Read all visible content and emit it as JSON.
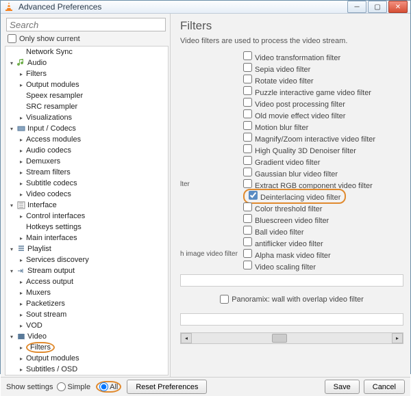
{
  "window": {
    "title": "Advanced Preferences"
  },
  "search": {
    "placeholder": "Search"
  },
  "only_show": "Only show current",
  "tree": {
    "items": [
      {
        "label": "Network Sync",
        "child": true
      },
      {
        "label": "Audio",
        "expand": "▾",
        "icon": "audio"
      },
      {
        "label": "Filters",
        "child": true,
        "caret": "▸"
      },
      {
        "label": "Output modules",
        "child": true,
        "caret": "▸"
      },
      {
        "label": "Speex resampler",
        "child": true
      },
      {
        "label": "SRC resampler",
        "child": true
      },
      {
        "label": "Visualizations",
        "child": true,
        "caret": "▸"
      },
      {
        "label": "Input / Codecs",
        "expand": "▾",
        "icon": "codec"
      },
      {
        "label": "Access modules",
        "child": true,
        "caret": "▸"
      },
      {
        "label": "Audio codecs",
        "child": true,
        "caret": "▸"
      },
      {
        "label": "Demuxers",
        "child": true,
        "caret": "▸"
      },
      {
        "label": "Stream filters",
        "child": true,
        "caret": "▸"
      },
      {
        "label": "Subtitle codecs",
        "child": true,
        "caret": "▸"
      },
      {
        "label": "Video codecs",
        "child": true,
        "caret": "▸"
      },
      {
        "label": "Interface",
        "expand": "▾",
        "icon": "iface"
      },
      {
        "label": "Control interfaces",
        "child": true,
        "caret": "▸"
      },
      {
        "label": "Hotkeys settings",
        "child": true
      },
      {
        "label": "Main interfaces",
        "child": true,
        "caret": "▸"
      },
      {
        "label": "Playlist",
        "expand": "▾",
        "icon": "playlist"
      },
      {
        "label": "Services discovery",
        "child": true,
        "caret": "▸"
      },
      {
        "label": "Stream output",
        "expand": "▾",
        "icon": "sout"
      },
      {
        "label": "Access output",
        "child": true,
        "caret": "▸"
      },
      {
        "label": "Muxers",
        "child": true,
        "caret": "▸"
      },
      {
        "label": "Packetizers",
        "child": true,
        "caret": "▸"
      },
      {
        "label": "Sout stream",
        "child": true,
        "caret": "▸"
      },
      {
        "label": "VOD",
        "child": true,
        "caret": "▸"
      },
      {
        "label": "Video",
        "expand": "▾",
        "icon": "video"
      },
      {
        "label": "Filters",
        "child": true,
        "caret": "▸",
        "circled": true
      },
      {
        "label": "Output modules",
        "child": true,
        "caret": "▸"
      },
      {
        "label": "Subtitles / OSD",
        "child": true,
        "caret": "▸"
      }
    ]
  },
  "right": {
    "title": "Filters",
    "desc": "Video filters are used to process the video stream.",
    "rows": [
      {
        "side": "",
        "label": "Video transformation filter"
      },
      {
        "side": "",
        "label": "Sepia video filter"
      },
      {
        "side": "",
        "label": "Rotate video filter"
      },
      {
        "side": "",
        "label": "Puzzle interactive game video filter"
      },
      {
        "side": "",
        "label": "Video post processing filter"
      },
      {
        "side": "",
        "label": "Old movie effect video filter"
      },
      {
        "side": "",
        "label": "Motion blur filter"
      },
      {
        "side": "",
        "label": "Magnify/Zoom interactive video filter"
      },
      {
        "side": "",
        "label": "High Quality 3D Denoiser filter"
      },
      {
        "side": "",
        "label": "Gradient video filter"
      },
      {
        "side": "",
        "label": "Gaussian blur video filter"
      },
      {
        "side": "lter",
        "label": "Extract RGB component video filter"
      },
      {
        "side": "",
        "label": "Deinterlacing video filter",
        "checked": true,
        "circled": true
      },
      {
        "side": "",
        "label": "Color threshold filter"
      },
      {
        "side": "",
        "label": "Bluescreen video filter"
      },
      {
        "side": "",
        "label": "Ball video filter"
      },
      {
        "side": "",
        "label": "antiflicker video filter"
      },
      {
        "side": "h image video filter",
        "label": "Alpha mask video filter"
      },
      {
        "side": "",
        "label": "Video scaling filter"
      }
    ],
    "pano": "Panoramix: wall with overlap video filter"
  },
  "bottom": {
    "show": "Show settings",
    "simple": "Simple",
    "all": "All",
    "reset": "Reset Preferences",
    "save": "Save",
    "cancel": "Cancel"
  }
}
